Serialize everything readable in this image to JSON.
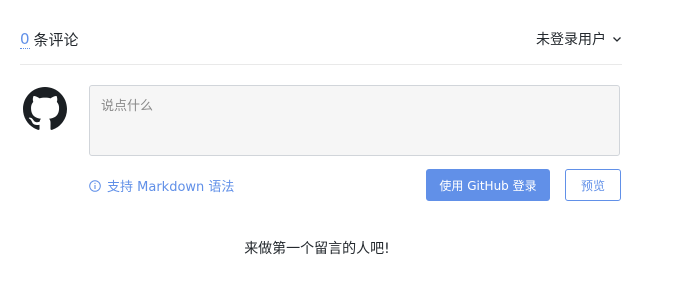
{
  "header": {
    "count": "0",
    "count_label": "条评论",
    "user_label": "未登录用户"
  },
  "editor": {
    "placeholder": "说点什么"
  },
  "footer": {
    "markdown_tip": "支持 Markdown 语法",
    "login_label": "使用 GitHub 登录",
    "preview_label": "预览"
  },
  "empty_message": "来做第一个留言的人吧!",
  "icons": {
    "avatar": "github-icon",
    "user_menu": "chevron-down-icon",
    "markdown_tip": "info-icon"
  },
  "colors": {
    "accent": "#6190e8",
    "text": "#24292e",
    "textarea_bg": "#f6f6f6"
  }
}
